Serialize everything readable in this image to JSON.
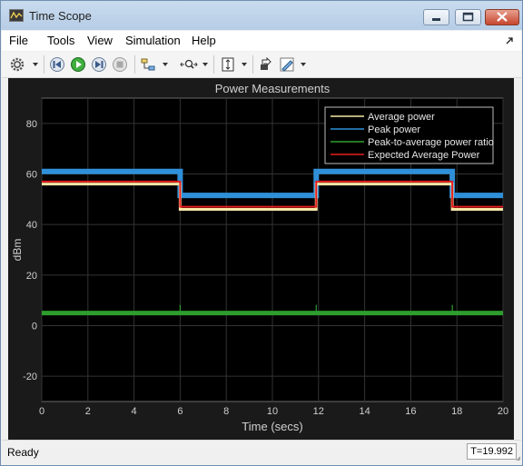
{
  "window": {
    "title": "Time Scope"
  },
  "menu": [
    "File",
    "Tools",
    "View",
    "Simulation",
    "Help"
  ],
  "toolbar_icons": [
    "configure-icon",
    "step-back-icon",
    "run-icon",
    "step-forward-icon",
    "stop-icon",
    "triggers-icon",
    "zoom-icon",
    "autoscale-icon",
    "highlight-icon",
    "style-icon"
  ],
  "status": {
    "text": "Ready",
    "time": "T=19.992"
  },
  "colors": {
    "background": "#000000",
    "axes": "#1a1a1a",
    "grid": "#333333",
    "average": "#f5e7a6",
    "peak": "#2f8fd8",
    "ratio": "#2e9d2e",
    "expected": "#e61e1e"
  },
  "chart_data": {
    "type": "line",
    "title": "Power Measurements",
    "xlabel": "Time (secs)",
    "ylabel": "dBm",
    "xlim": [
      0,
      20
    ],
    "ylim": [
      -30,
      90
    ],
    "xticks": [
      "0",
      "2",
      "4",
      "6",
      "8",
      "10",
      "12",
      "14",
      "16",
      "18",
      "20"
    ],
    "yticks": [
      "-20",
      "0",
      "20",
      "40",
      "60",
      "80"
    ],
    "grid": true,
    "legend_position": "top-right",
    "series": [
      {
        "name": "Average power",
        "color": "#f5e7a6",
        "x": [
          0,
          6,
          6,
          11.9,
          11.9,
          17.8,
          17.8,
          20
        ],
        "y": [
          56,
          56,
          46,
          46,
          56,
          56,
          46,
          46
        ]
      },
      {
        "name": "Peak power",
        "color": "#2f8fd8",
        "x": [
          0,
          6,
          6,
          11.9,
          11.9,
          17.8,
          17.8,
          20
        ],
        "y": [
          61,
          61,
          51.5,
          51.5,
          61,
          61,
          51.5,
          51.5
        ]
      },
      {
        "name": "Peak-to-average power ratio",
        "color": "#2e9d2e",
        "x": [
          0,
          20
        ],
        "y": [
          5,
          5
        ]
      },
      {
        "name": "Expected Average Power",
        "color": "#e61e1e",
        "x": [
          0,
          6,
          6,
          11.9,
          11.9,
          17.8,
          17.8,
          20
        ],
        "y": [
          57,
          57,
          47,
          47,
          57,
          57,
          47,
          47
        ]
      }
    ]
  }
}
